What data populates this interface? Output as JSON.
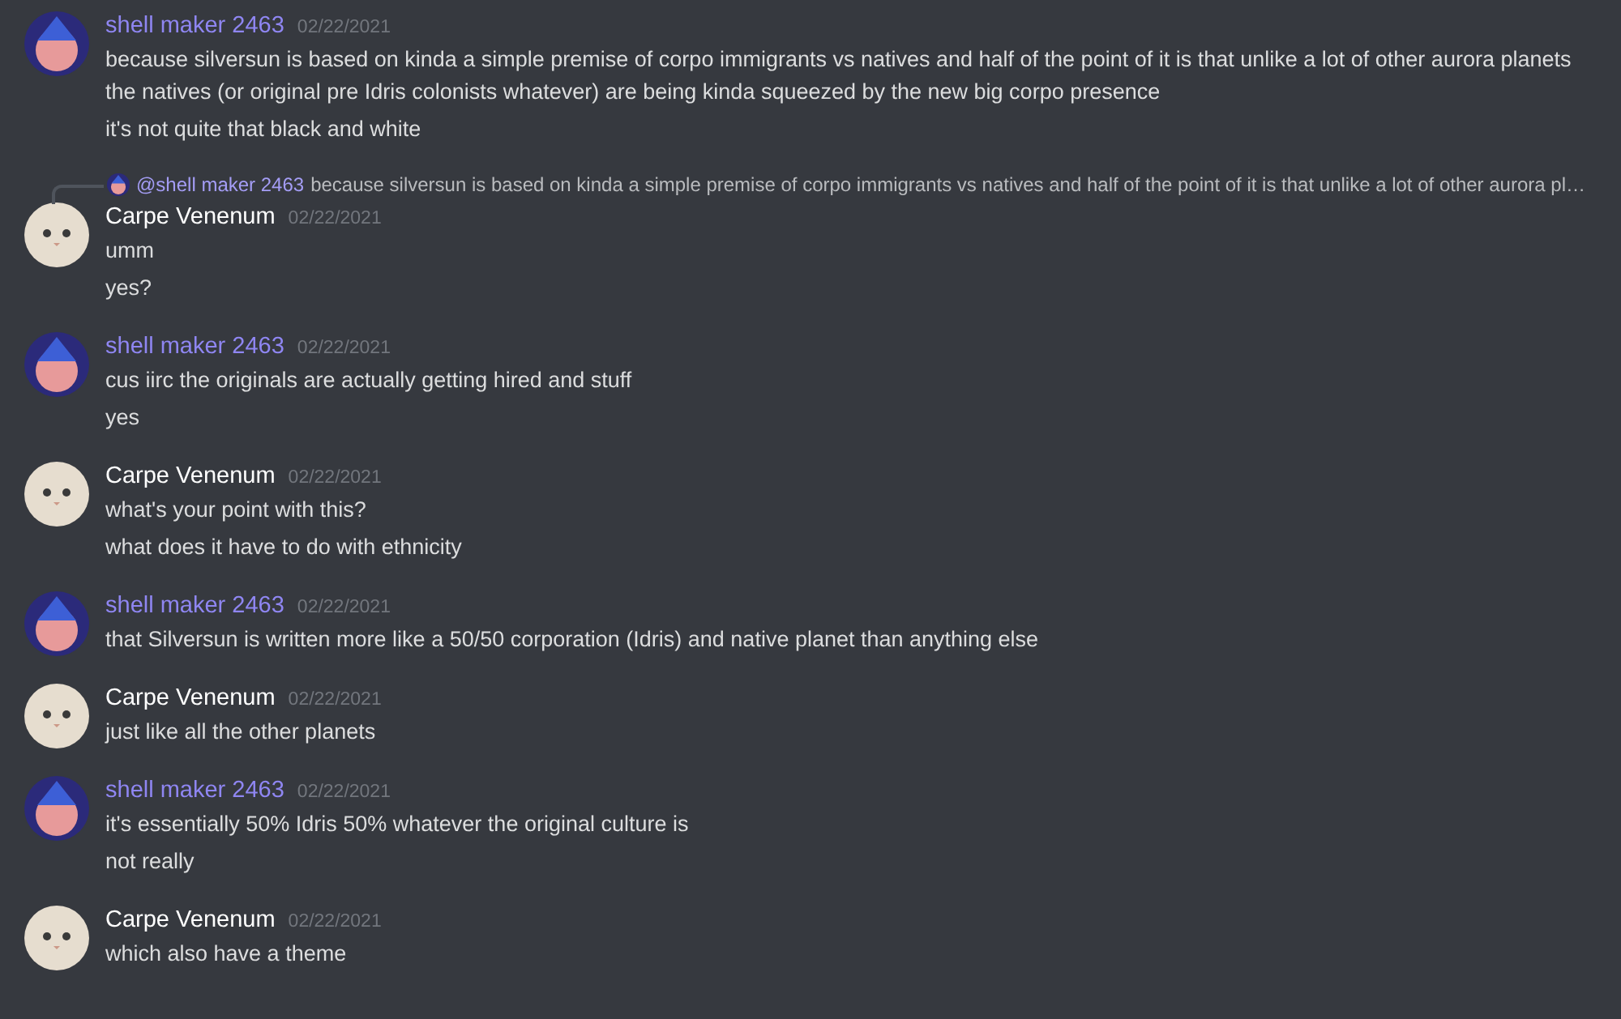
{
  "messages": [
    {
      "author": "shell maker 2463",
      "color": "#8f86f2",
      "avatar": {
        "kind": "cartoon"
      },
      "time": "02/22/2021",
      "lines": [
        "because silversun is based on kinda a simple premise of corpo immigrants vs natives and half of the point of it is that unlike a lot of other aurora planets the natives (or original pre Idris colonists whatever) are being kinda squeezed by the new big corpo presence",
        "it's not quite that black and white"
      ]
    },
    {
      "author": "Carpe Venenum",
      "color": "#ffffff",
      "avatar": {
        "kind": "cat"
      },
      "time": "02/22/2021",
      "reply": {
        "author": "@shell maker 2463",
        "text": "because silversun is based on kinda a simple premise of corpo immigrants vs natives and half of the point of it is that unlike a lot of other aurora pl…"
      },
      "lines": [
        "umm",
        "yes?"
      ]
    },
    {
      "author": "shell maker 2463",
      "color": "#8f86f2",
      "avatar": {
        "kind": "cartoon"
      },
      "time": "02/22/2021",
      "lines": [
        "cus iirc the originals are actually getting hired and stuff",
        "yes"
      ]
    },
    {
      "author": "Carpe Venenum",
      "color": "#ffffff",
      "avatar": {
        "kind": "cat"
      },
      "time": "02/22/2021",
      "lines": [
        "what's your point with this?",
        "what does it have to do with ethnicity"
      ]
    },
    {
      "author": "shell maker 2463",
      "color": "#8f86f2",
      "avatar": {
        "kind": "cartoon"
      },
      "time": "02/22/2021",
      "lines": [
        "that Silversun is written more like a 50/50 corporation (Idris) and native planet than anything else"
      ]
    },
    {
      "author": "Carpe Venenum",
      "color": "#ffffff",
      "avatar": {
        "kind": "cat"
      },
      "time": "02/22/2021",
      "lines": [
        "just like all the other planets"
      ]
    },
    {
      "author": "shell maker 2463",
      "color": "#8f86f2",
      "avatar": {
        "kind": "cartoon"
      },
      "time": "02/22/2021",
      "lines": [
        "it's essentially 50% Idris 50% whatever the original culture is",
        "not really"
      ]
    },
    {
      "author": "Carpe Venenum",
      "color": "#ffffff",
      "avatar": {
        "kind": "cat"
      },
      "time": "02/22/2021",
      "lines": [
        "which also have a theme"
      ]
    }
  ]
}
